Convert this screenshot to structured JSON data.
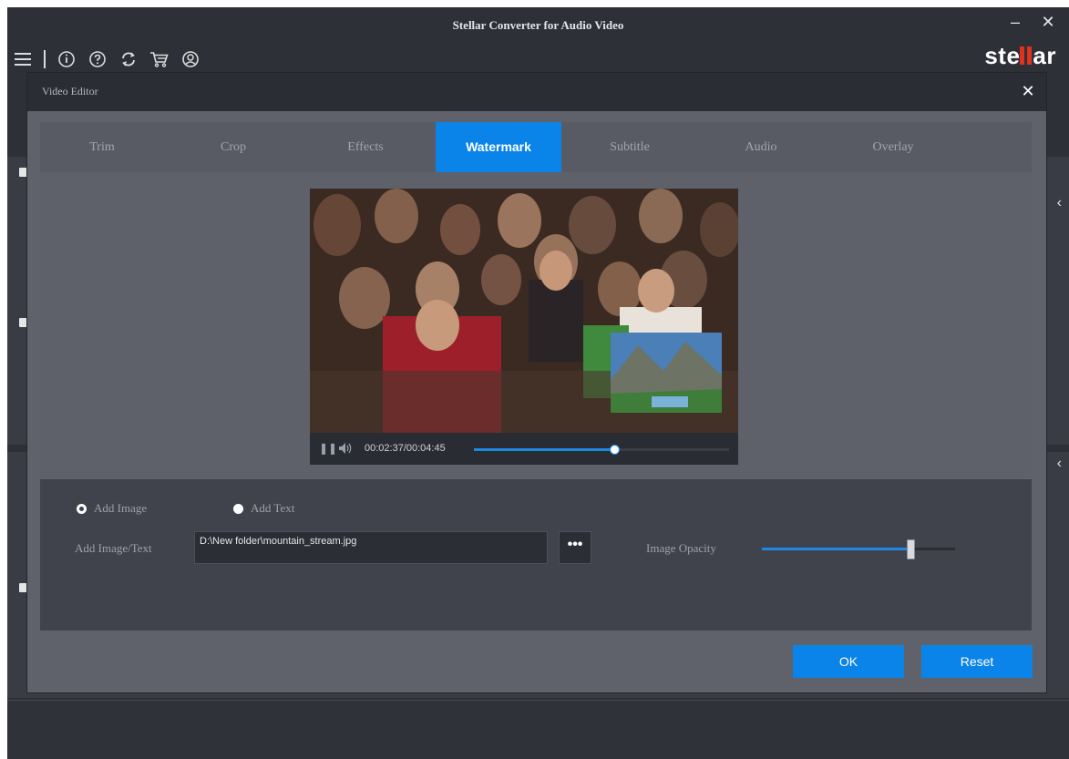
{
  "window": {
    "title": "Stellar Converter for Audio Video",
    "minimize_glyph": "–",
    "close_glyph": "✕",
    "logo_left": "ste",
    "logo_right": "ar"
  },
  "toolbar": {
    "icons": [
      "menu-icon",
      "info-icon",
      "help-icon",
      "refresh-icon",
      "cart-icon",
      "account-icon"
    ]
  },
  "dialog": {
    "title": "Video Editor",
    "close_glyph": "✕",
    "tabs": [
      {
        "label": "Trim"
      },
      {
        "label": "Crop"
      },
      {
        "label": "Effects"
      },
      {
        "label": "Watermark",
        "active": true
      },
      {
        "label": "Subtitle"
      },
      {
        "label": "Audio"
      },
      {
        "label": "Overlay"
      }
    ],
    "player": {
      "time": "00:02:37/00:04:45",
      "progress": 0.55
    },
    "options": {
      "add_image": "Add Image",
      "add_text": "Add Text",
      "selected": "Add Image",
      "add_image_text_label": "Add Image/Text",
      "path_value": "D:\\New folder\\mountain_stream.jpg",
      "browse_glyph": "•••",
      "opacity_label": "Image Opacity",
      "opacity_value": 0.77
    },
    "ok_label": "OK",
    "reset_label": "Reset"
  },
  "colors": {
    "accent": "#0a84e8",
    "logo_accent": "#e0301e",
    "app_background": "#2e3038",
    "dialog_background": "#5f616b"
  }
}
